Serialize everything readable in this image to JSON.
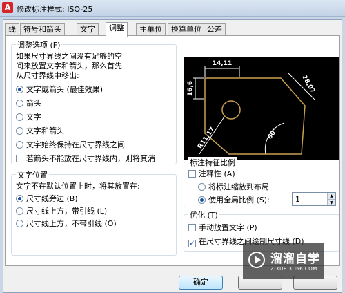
{
  "window": {
    "title": "修改标注样式: ISO-25",
    "app_icon": "A"
  },
  "tabs": [
    {
      "label": "线"
    },
    {
      "label": "符号和箭头"
    },
    {
      "label": "文字"
    },
    {
      "label": "调整"
    },
    {
      "label": "主单位"
    },
    {
      "label": "换算单位"
    },
    {
      "label": "公差"
    }
  ],
  "active_tab": "调整",
  "fit_options": {
    "legend": "调整选项 (F)",
    "description": [
      "如果尺寸界线之间没有足够的空",
      "间来放置文字和箭头，那么首先",
      "从尺寸界线中移出:"
    ],
    "options": [
      {
        "label": "文字或箭头 (最佳效果)",
        "selected": true
      },
      {
        "label": "箭头",
        "selected": false
      },
      {
        "label": "文字",
        "selected": false
      },
      {
        "label": "文字和箭头",
        "selected": false
      },
      {
        "label": "文字始终保持在尺寸界线之间",
        "selected": false
      }
    ],
    "suppress_arrows": {
      "label": "若箭头不能放在尺寸界线内，则将其消",
      "checked": false
    }
  },
  "text_placement": {
    "legend": "文字位置",
    "description": "文字不在默认位置上时，将其放置在:",
    "options": [
      {
        "label": "尺寸线旁边 (B)",
        "selected": true
      },
      {
        "label": "尺寸线上方，带引线 (L)",
        "selected": false
      },
      {
        "label": "尺寸线上方，不带引线 (O)",
        "selected": false
      }
    ]
  },
  "preview": {
    "dim_top": "14,11",
    "dim_left": "16,6",
    "dim_right": "28,07",
    "dim_angle": "60°",
    "dim_radius": "R11,17",
    "colors": {
      "background": "#000000",
      "geometry": "#c8a050",
      "dimension": "#ffffff"
    }
  },
  "scale": {
    "legend": "标注特征比例",
    "annotative": {
      "label": "注释性 (A)",
      "checked": false
    },
    "options": [
      {
        "label": "将标注缩放到布局",
        "selected": false
      },
      {
        "label": "使用全局比例 (S):",
        "selected": true
      }
    ],
    "global_scale_value": "1"
  },
  "fine_tuning": {
    "legend": "优化 (T)",
    "options": [
      {
        "label": "手动放置文字 (P)",
        "checked": false
      },
      {
        "label": "在尺寸界线之间绘制尺寸线 (D)",
        "checked": true
      }
    ]
  },
  "buttons": {
    "ok": "确定"
  },
  "watermark": {
    "title": "溜溜自学",
    "url": "ZIXUE.3D66.COM"
  }
}
